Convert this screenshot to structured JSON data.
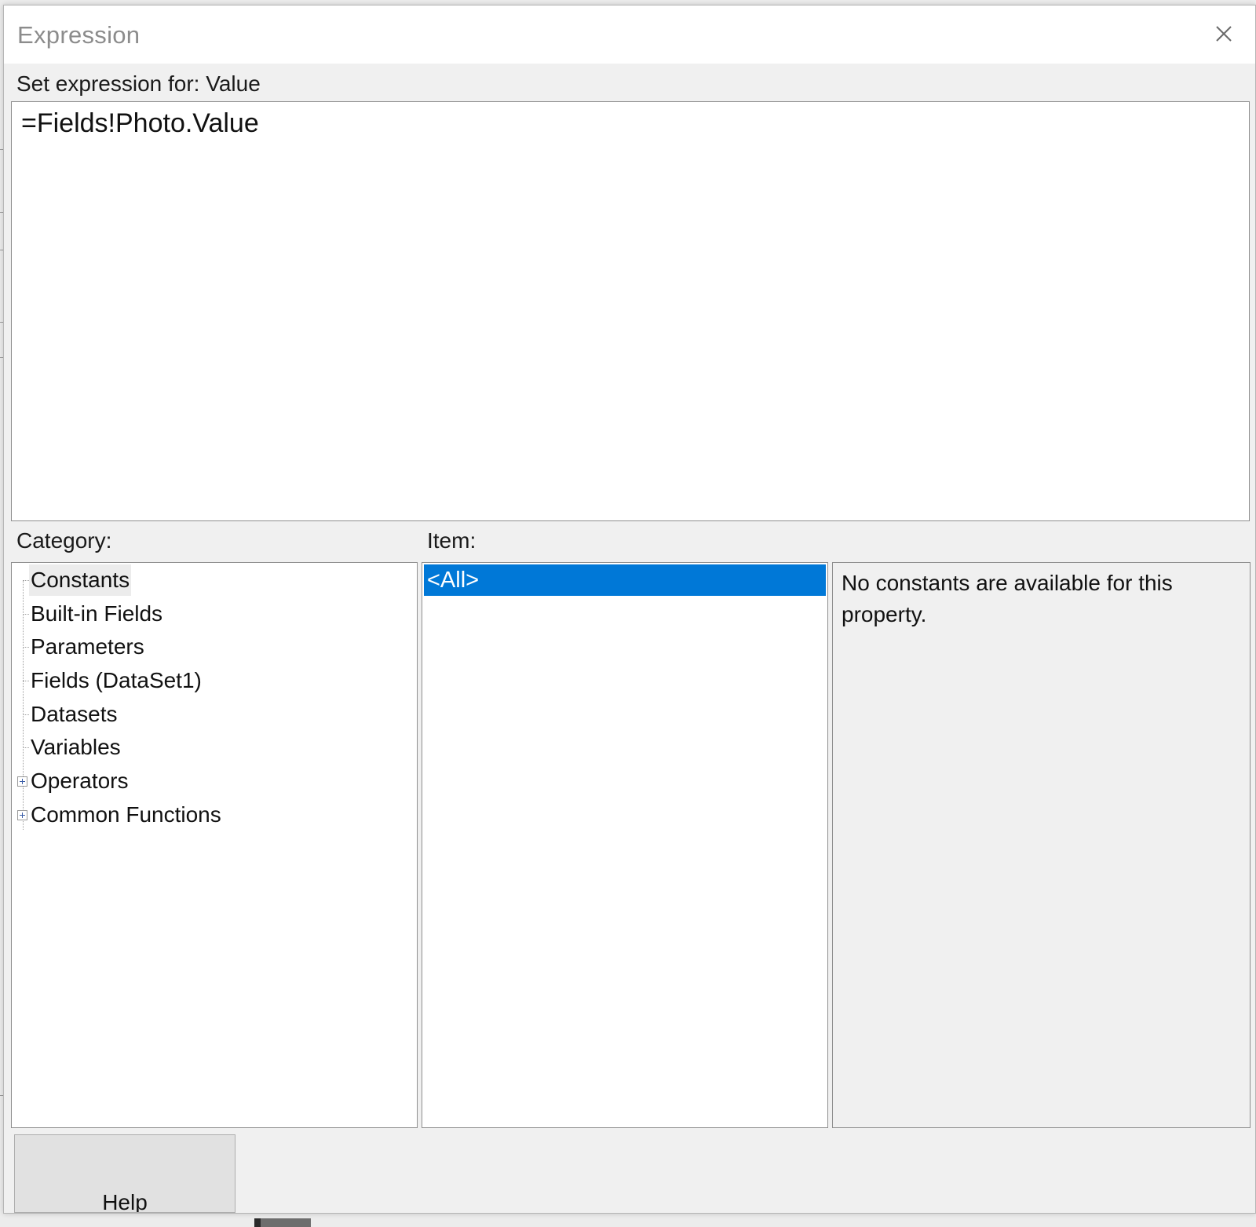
{
  "window": {
    "title": "Expression"
  },
  "expression": {
    "label": "Set expression for: Value",
    "value": "=Fields!Photo.Value"
  },
  "category": {
    "label": "Category:",
    "items": [
      {
        "label": "Constants",
        "selected": true,
        "expandable": false
      },
      {
        "label": "Built-in Fields",
        "selected": false,
        "expandable": false
      },
      {
        "label": "Parameters",
        "selected": false,
        "expandable": false
      },
      {
        "label": "Fields (DataSet1)",
        "selected": false,
        "expandable": false
      },
      {
        "label": "Datasets",
        "selected": false,
        "expandable": false
      },
      {
        "label": "Variables",
        "selected": false,
        "expandable": false
      },
      {
        "label": "Operators",
        "selected": false,
        "expandable": true
      },
      {
        "label": "Common Functions",
        "selected": false,
        "expandable": true
      }
    ]
  },
  "item": {
    "label": "Item:",
    "items": [
      {
        "label": "<All>",
        "selected": true
      }
    ]
  },
  "description": {
    "text": "No constants are available for this property."
  },
  "buttons": {
    "help_label": "Help"
  },
  "colors": {
    "selection": "#0078d7",
    "dialog_background": "#f0f0f0",
    "titlebar_background": "#ffffff"
  }
}
